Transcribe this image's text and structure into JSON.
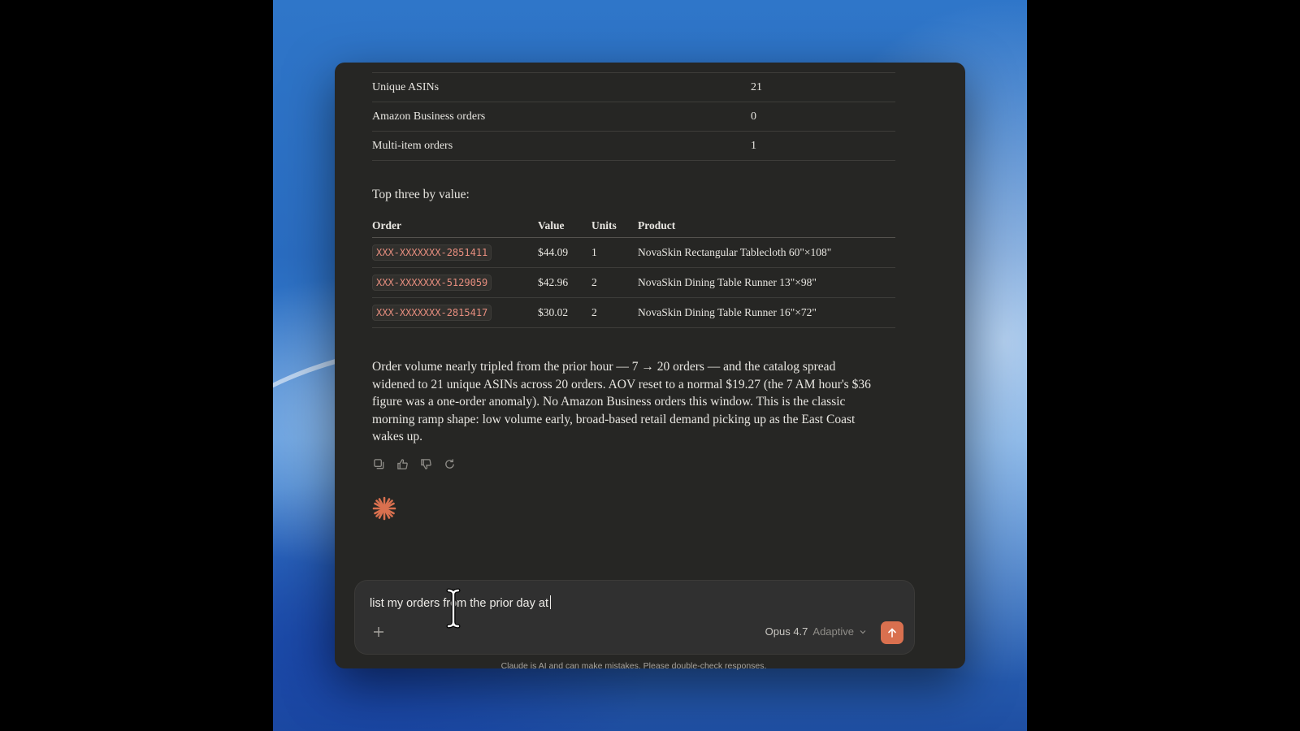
{
  "summary_rows": [
    {
      "label": "Unique ASINs",
      "value": "21"
    },
    {
      "label": "Amazon Business orders",
      "value": "0"
    },
    {
      "label": "Multi-item orders",
      "value": "1"
    }
  ],
  "top_heading": "Top three by value:",
  "orders_table": {
    "headers": {
      "order": "Order",
      "value": "Value",
      "units": "Units",
      "product": "Product"
    },
    "rows": [
      {
        "order": "XXX-XXXXXXX-2851411",
        "value": "$44.09",
        "units": "1",
        "product": "NovaSkin Rectangular Tablecloth 60\"×108\""
      },
      {
        "order": "XXX-XXXXXXX-5129059",
        "value": "$42.96",
        "units": "2",
        "product": "NovaSkin Dining Table Runner 13\"×98\""
      },
      {
        "order": "XXX-XXXXXXX-2815417",
        "value": "$30.02",
        "units": "2",
        "product": "NovaSkin Dining Table Runner 16\"×72\""
      }
    ]
  },
  "paragraph": "Order volume nearly tripled from the prior hour — 7 → 20 orders — and the catalog spread widened to 21 unique ASINs across 20 orders. AOV reset to a normal $19.27 (the 7 AM hour's $36 figure was a one-order anomaly). No Amazon Business orders this window. This is the classic morning ramp shape: low volume early, broad-based retail demand picking up as the East Coast wakes up.",
  "actions": [
    "copy-icon",
    "thumbs-up-icon",
    "thumbs-down-icon",
    "retry-icon"
  ],
  "composer": {
    "input_value": "list my orders from the prior day at",
    "model_name": "Opus 4.7",
    "mode": "Adaptive"
  },
  "disclaimer": "Claude is AI and can make mistakes. Please double-check responses.",
  "colors": {
    "accent": "#d9704f",
    "code_text": "#e58d7e",
    "window_bg": "#262624"
  }
}
